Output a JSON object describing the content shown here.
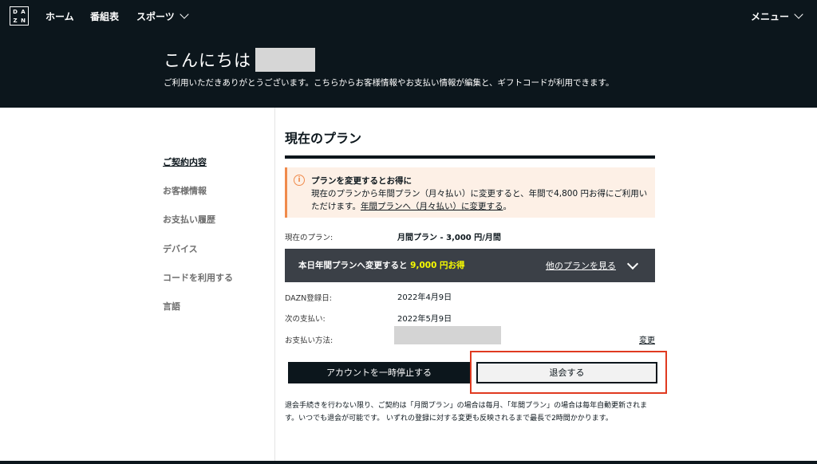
{
  "topnav": {
    "logo_letters": [
      "D",
      "A",
      "Z",
      "N"
    ],
    "home": "ホーム",
    "schedule": "番組表",
    "sports": "スポーツ",
    "menu": "メニュー"
  },
  "hero": {
    "greeting": "こんにちは",
    "subtitle": "ご利用いただきありがとうございます。こちらからお客様情報やお支払い情報が編集と、ギフトコードが利用できます。"
  },
  "sidebar": {
    "items": [
      {
        "label": "ご契約内容",
        "active": true
      },
      {
        "label": "お客様情報",
        "active": false
      },
      {
        "label": "お支払い履歴",
        "active": false
      },
      {
        "label": "デバイス",
        "active": false
      },
      {
        "label": "コードを利用する",
        "active": false
      },
      {
        "label": "言語",
        "active": false
      }
    ]
  },
  "main": {
    "title": "現在のプラン",
    "notice": {
      "icon": "info-icon",
      "icon_glyph": "i",
      "title": "プランを変更するとお得に",
      "body_prefix": "現在のプランから年間プラン（月々払い）に変更すると、年間で4,800 円お得にご利用いただけます。",
      "link": "年間プランへ（月々払い）に変更する",
      "body_suffix": "。",
      "accent_color": "#f08a4b"
    },
    "current_plan_label": "現在のプラン:",
    "current_plan_value": "月間プラン - 3,000 円/月間",
    "upgrade": {
      "text_prefix": "本日年間プランへ変更すると",
      "highlight": "9,000 円お得",
      "link": "他のプランを見る",
      "highlight_color": "#f8fc00"
    },
    "registered_label": "DAZN登録日:",
    "registered_value": "2022年4月9日",
    "next_payment_label": "次の支払い:",
    "next_payment_value": "2022年5月9日",
    "payment_method_label": "お支払い方法:",
    "change_link": "変更",
    "pause_button": "アカウントを一時停止する",
    "cancel_button": "退会する",
    "footnote": "退会手続きを行わない限り、ご契約は「月間プラン」の場合は毎月、「年間プラン」の場合は毎年自動更新されます。いつでも退会が可能です。 いずれの登録に対する変更も反映されるまで最長で2時間かかります。"
  },
  "colors": {
    "background_dark": "#0c161c",
    "highlight_frame": "#e03a20"
  }
}
